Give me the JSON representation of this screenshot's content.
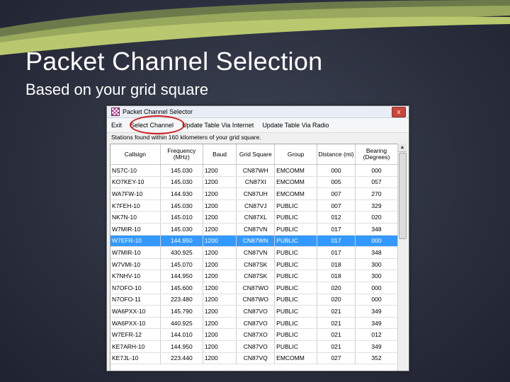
{
  "slide": {
    "title": "Packet Channel Selection",
    "subtitle": "Based on your grid square"
  },
  "window": {
    "title": "Packet Channel Selector",
    "close_label": "x",
    "menu": [
      "Exit",
      "Select Channel",
      "Update Table Via Internet",
      "Update Table Via Radio"
    ],
    "status": "Stations found within 160 kilometers of your grid square."
  },
  "table": {
    "columns": [
      "Callsign",
      "Frequency (MHz)",
      "Baud",
      "Grid Square",
      "Group",
      "Distance (mi)",
      "Bearing (Degrees)"
    ],
    "rows": [
      [
        "NS7C-10",
        "145.030",
        "1200",
        "CN87WH",
        "EMCOMM",
        "000",
        "000"
      ],
      [
        "KO7KEY-10",
        "145.030",
        "1200",
        "CN87XI",
        "EMCOMM",
        "005",
        "057"
      ],
      [
        "WA7FW-10",
        "144.930",
        "1200",
        "CN87UH",
        "EMCOMM",
        "007",
        "270"
      ],
      [
        "K7FEH-10",
        "145.030",
        "1200",
        "CN87VJ",
        "PUBLIC",
        "007",
        "329"
      ],
      [
        "NK7N-10",
        "145.010",
        "1200",
        "CN87XL",
        "PUBLIC",
        "012",
        "020"
      ],
      [
        "W7MIR-10",
        "145.030",
        "1200",
        "CN87VN",
        "PUBLIC",
        "017",
        "348"
      ],
      [
        "W7EFR-10",
        "144.950",
        "1200",
        "CN87WN",
        "PUBLIC",
        "017",
        "000"
      ],
      [
        "W7MIR-10",
        "430.925",
        "1200",
        "CN87VN",
        "PUBLIC",
        "017",
        "348"
      ],
      [
        "W7VMI-10",
        "145.070",
        "1200",
        "CN87SK",
        "PUBLIC",
        "018",
        "300"
      ],
      [
        "K7NHV-10",
        "144.950",
        "1200",
        "CN87SK",
        "PUBLIC",
        "018",
        "300"
      ],
      [
        "N7OFO-10",
        "145.600",
        "1200",
        "CN87WO",
        "PUBLIC",
        "020",
        "000"
      ],
      [
        "N7OFO-11",
        "223.480",
        "1200",
        "CN87WO",
        "PUBLIC",
        "020",
        "000"
      ],
      [
        "WA6PXX-10",
        "145.790",
        "1200",
        "CN87VO",
        "PUBLIC",
        "021",
        "349"
      ],
      [
        "WA6PXX-10",
        "440.925",
        "1200",
        "CN87VO",
        "PUBLIC",
        "021",
        "349"
      ],
      [
        "W7EFR-12",
        "144.010",
        "1200",
        "CN87XO",
        "PUBLIC",
        "021",
        "012"
      ],
      [
        "KE7ARH-10",
        "144.950",
        "1200",
        "CN87VO",
        "PUBLIC",
        "021",
        "349"
      ],
      [
        "KE7JL-10",
        "223.440",
        "1200",
        "CN87VQ",
        "EMCOMM",
        "027",
        "352"
      ]
    ],
    "selected_row": 6
  }
}
